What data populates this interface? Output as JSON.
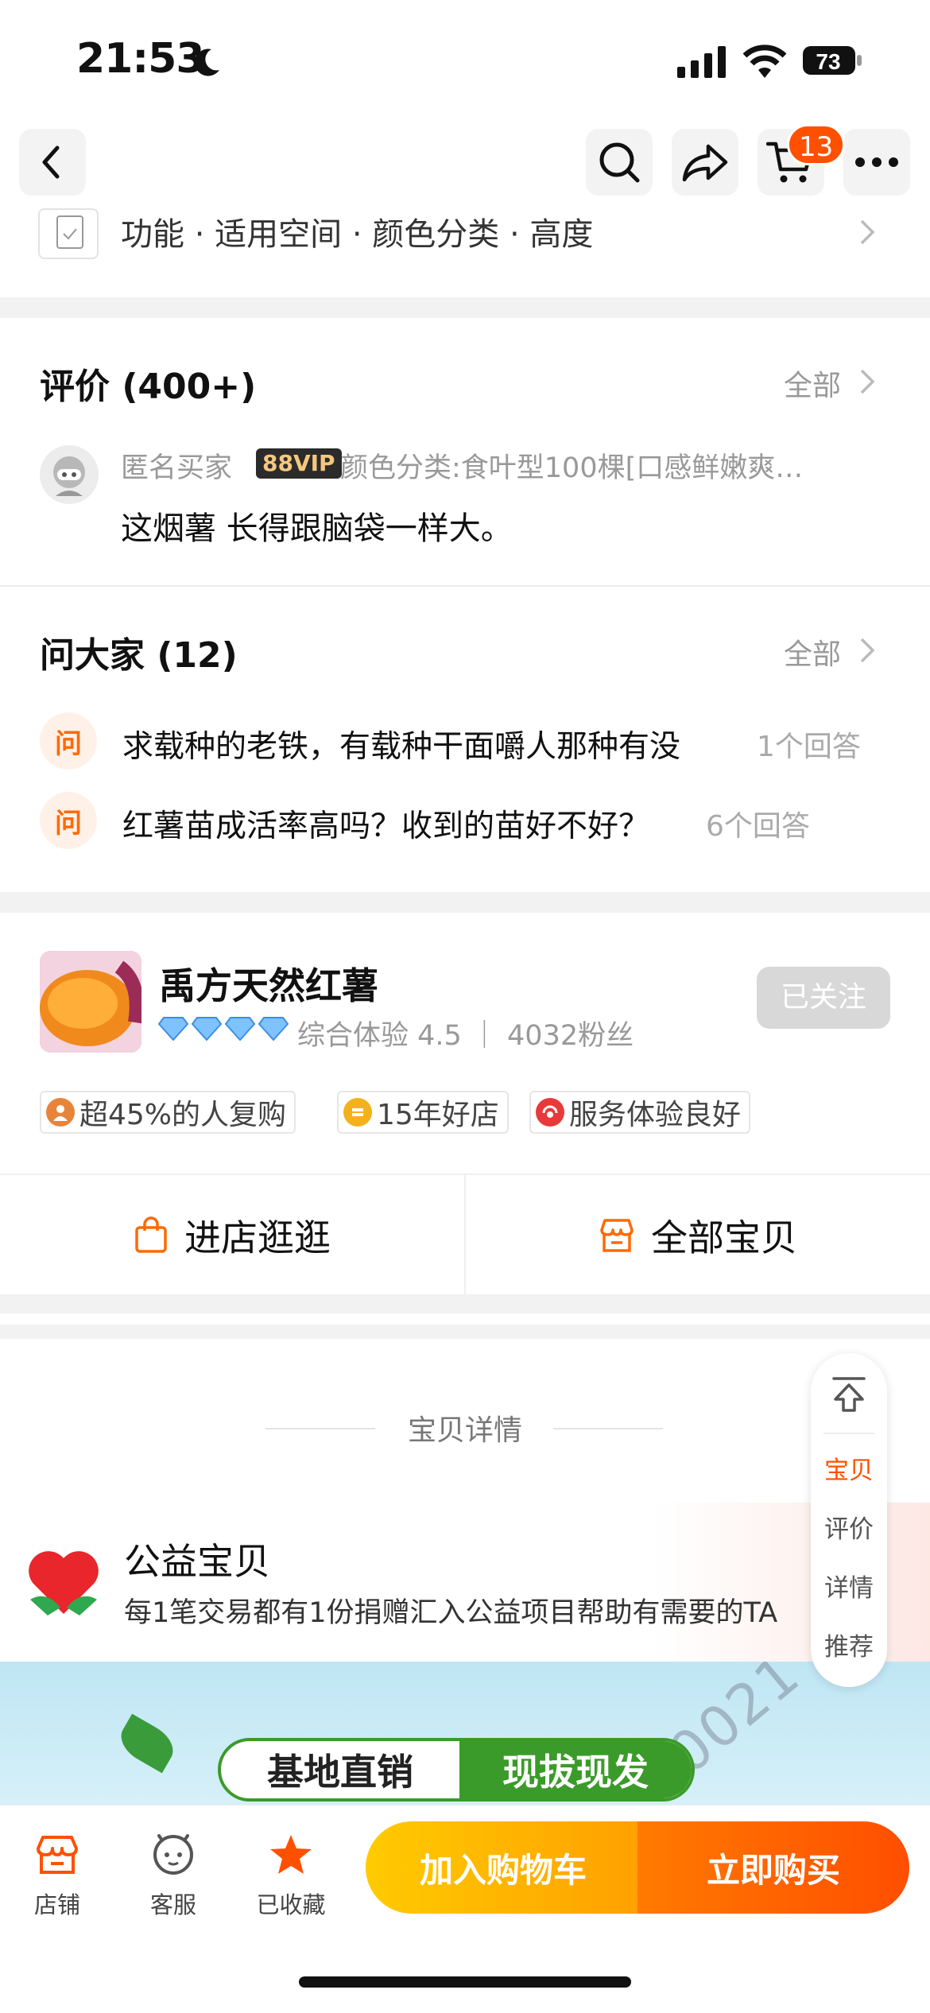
{
  "status": {
    "time": "21:53",
    "battery": "73"
  },
  "nav": {
    "cart_count": "13"
  },
  "params": {
    "text": "功能 · 适用空间 · 颜色分类 · 高度"
  },
  "reviews": {
    "title": "评价 (400+)",
    "more": "全部",
    "user": "匿名买家",
    "vip": "88VIP",
    "spec": "颜色分类:食叶型100棵[口感鲜嫩爽…",
    "text": "这烟薯 长得跟脑袋一样大。"
  },
  "qa": {
    "title": "问大家 (12)",
    "more": "全部",
    "icon_text": "问",
    "items": [
      {
        "question": "求载种的老铁，有载种干面嚼人那种有没",
        "answers": "1个回答"
      },
      {
        "question": "红薯苗成活率高吗？收到的苗好不好？",
        "answers": "6个回答"
      }
    ]
  },
  "shop": {
    "name": "禹方天然红薯",
    "stats": "综合体验 4.5 ｜ 4032粉丝",
    "follow": "已关注",
    "tags": [
      {
        "text": "超45%的人复购",
        "color": "#e8843a"
      },
      {
        "text": "15年好店",
        "color": "#f3b21b"
      },
      {
        "text": "服务体验良好",
        "color": "#e83a3a"
      }
    ],
    "enter_store": "进店逛逛",
    "all_items": "全部宝贝"
  },
  "detail": {
    "header": "宝贝详情"
  },
  "charity": {
    "title": "公益宝贝",
    "desc": "每1笔交易都有1份捐赠汇入公益项目帮助有需要的TA"
  },
  "banner": {
    "left": "基地直销",
    "right": "现拔现发",
    "watermark": "80021"
  },
  "side_nav": {
    "items": [
      "宝贝",
      "评价",
      "详情",
      "推荐"
    ],
    "active": "宝贝"
  },
  "bottom": {
    "tabs": [
      "店铺",
      "客服",
      "已收藏"
    ],
    "add_cart": "加入购物车",
    "buy_now": "立即购买"
  },
  "colors": {
    "accent": "#ff5000",
    "star": "#ff5000",
    "green": "#3b9b2a"
  }
}
